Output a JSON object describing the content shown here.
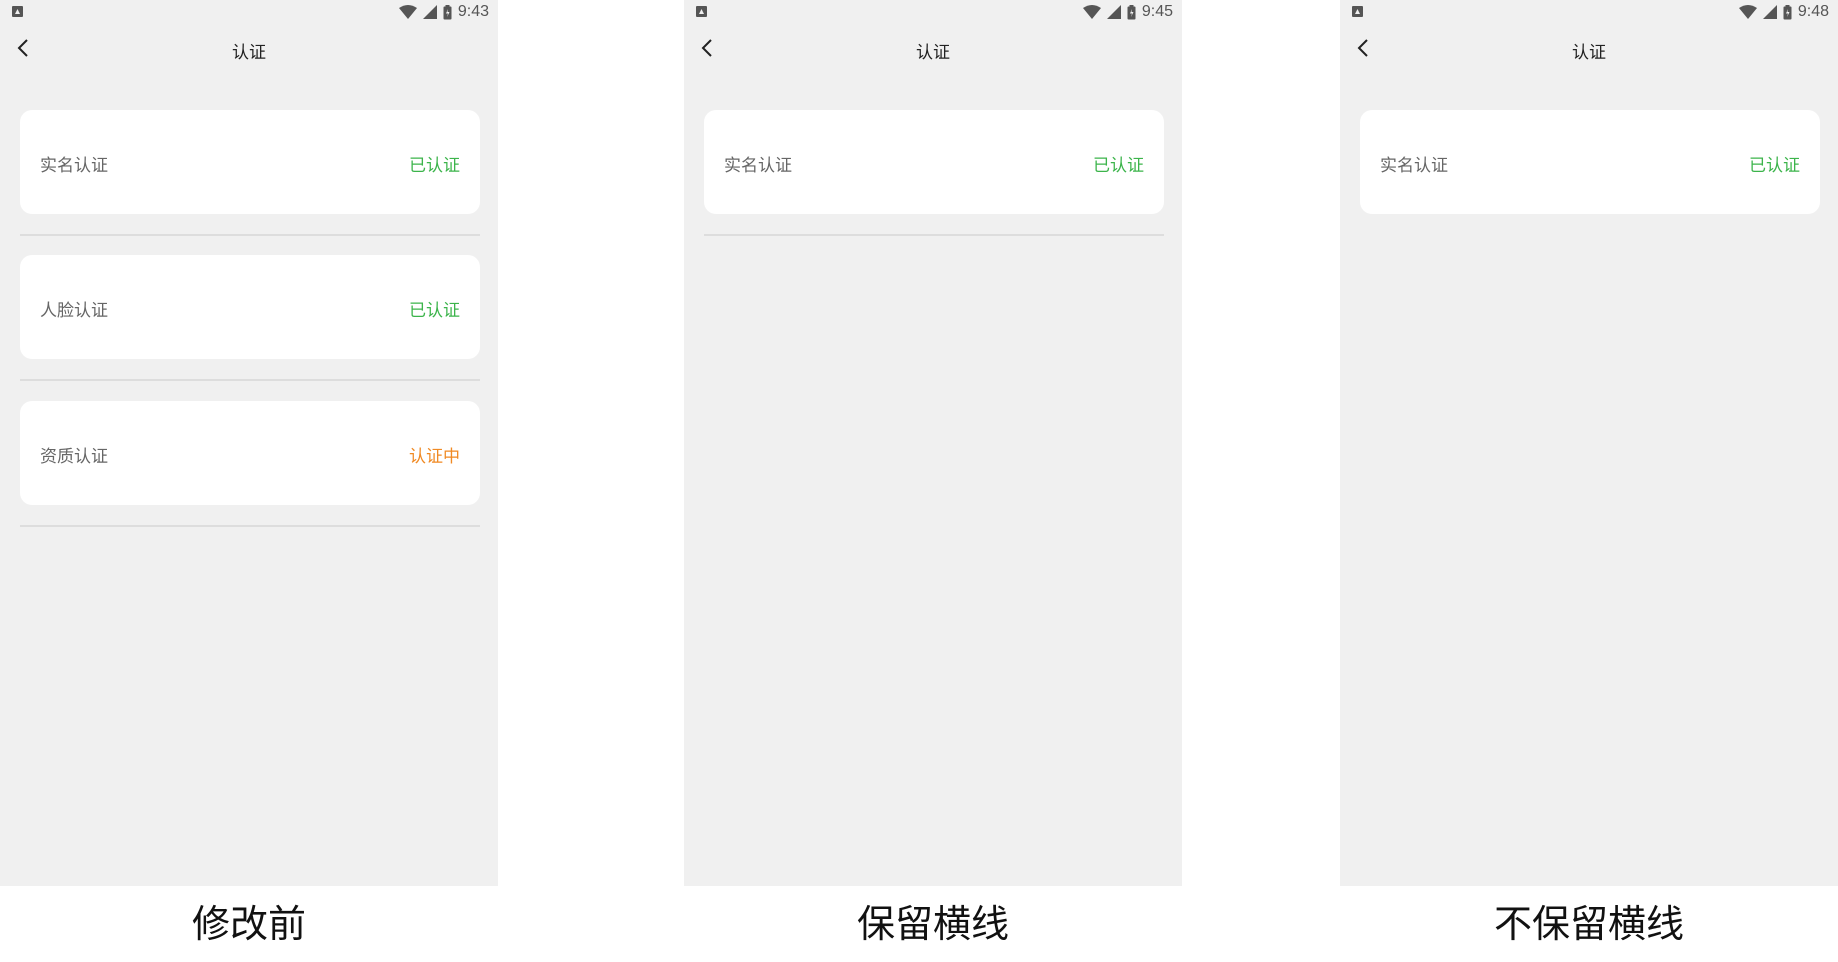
{
  "colors": {
    "verified": "#3cb44b",
    "pending": "#f08a24"
  },
  "panels": [
    {
      "status_time": "9:43",
      "title": "认证",
      "caption": "修改前",
      "cards": [
        {
          "label": "实名认证",
          "status": "已认证",
          "state": "verified"
        },
        {
          "label": "人脸认证",
          "status": "已认证",
          "state": "verified"
        },
        {
          "label": "资质认证",
          "status": "认证中",
          "state": "pending"
        }
      ]
    },
    {
      "status_time": "9:45",
      "title": "认证",
      "caption": "保留横线",
      "cards": [
        {
          "label": "实名认证",
          "status": "已认证",
          "state": "verified"
        }
      ]
    },
    {
      "status_time": "9:48",
      "title": "认证",
      "caption": "不保留横线",
      "cards": [
        {
          "label": "实名认证",
          "status": "已认证",
          "state": "verified"
        }
      ]
    }
  ]
}
